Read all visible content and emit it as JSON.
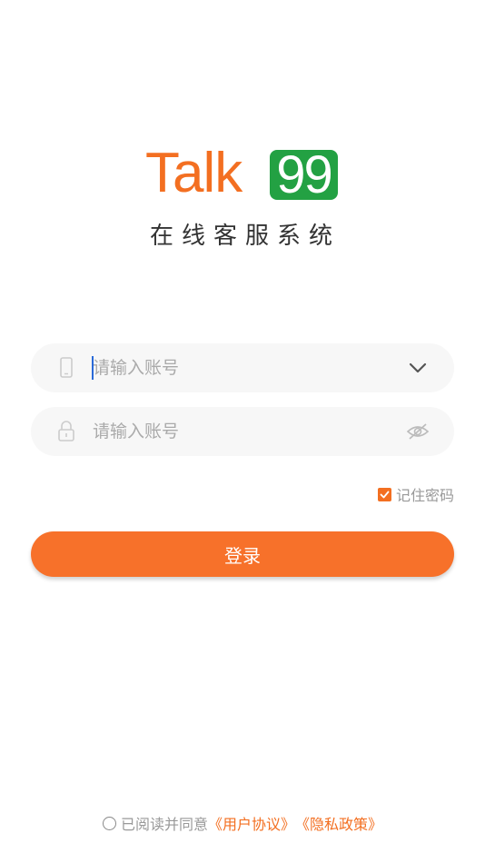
{
  "brand": {
    "logo_text": "Talk",
    "logo_number": "99",
    "subtitle": "在线客服系统",
    "colors": {
      "orange": "#f36f21",
      "green": "#23a143"
    }
  },
  "form": {
    "account": {
      "placeholder": "请输入账号",
      "value": "",
      "icon": "phone-icon",
      "action_icon": "chevron-down-icon"
    },
    "password": {
      "placeholder": "请输入账号",
      "value": "",
      "icon": "lock-icon",
      "action_icon": "eye-hidden-icon"
    },
    "remember": {
      "label": "记住密码",
      "checked": true
    },
    "login_label": "登录"
  },
  "agreement": {
    "checked": false,
    "text": "已阅读并同意",
    "user_agreement": "《用户协议》",
    "privacy_policy": "《隐私政策》"
  }
}
